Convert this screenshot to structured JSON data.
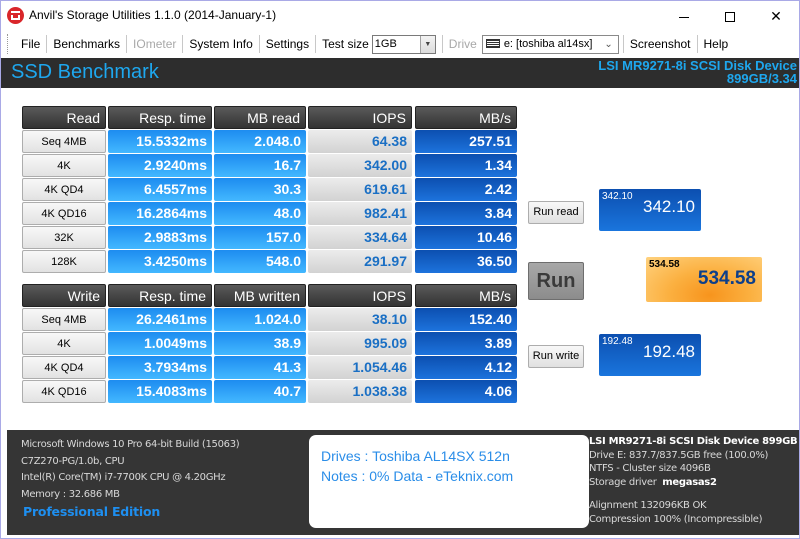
{
  "window": {
    "title": "Anvil's Storage Utilities 1.1.0 (2014-January-1)",
    "controls": {
      "minimize": "minimize",
      "maximize": "maximize",
      "close": "✕"
    }
  },
  "menu": {
    "items": [
      "File",
      "Benchmarks",
      "IOmeter",
      "System Info",
      "Settings"
    ],
    "test_size_label": "Test size",
    "test_size_value": "1GB",
    "drive_label": "Drive",
    "drive_value": "e: [toshiba al14sx]",
    "screenshot": "Screenshot",
    "help": "Help"
  },
  "header": {
    "title": "SSD Benchmark",
    "device_line1": "LSI MR9271-8i SCSI Disk Device",
    "device_line2": "899GB/3.34"
  },
  "read_table": {
    "headers": [
      "Read",
      "Resp. time",
      "MB read",
      "IOPS",
      "MB/s"
    ],
    "rows": [
      {
        "label": "Seq 4MB",
        "resp": "15.5332ms",
        "mb": "2.048.0",
        "iops": "64.38",
        "mbs": "257.51"
      },
      {
        "label": "4K",
        "resp": "2.9240ms",
        "mb": "16.7",
        "iops": "342.00",
        "mbs": "1.34"
      },
      {
        "label": "4K QD4",
        "resp": "6.4557ms",
        "mb": "30.3",
        "iops": "619.61",
        "mbs": "2.42"
      },
      {
        "label": "4K QD16",
        "resp": "16.2864ms",
        "mb": "48.0",
        "iops": "982.41",
        "mbs": "3.84"
      },
      {
        "label": "32K",
        "resp": "2.9883ms",
        "mb": "157.0",
        "iops": "334.64",
        "mbs": "10.46"
      },
      {
        "label": "128K",
        "resp": "3.4250ms",
        "mb": "548.0",
        "iops": "291.97",
        "mbs": "36.50"
      }
    ]
  },
  "write_table": {
    "headers": [
      "Write",
      "Resp. time",
      "MB written",
      "IOPS",
      "MB/s"
    ],
    "rows": [
      {
        "label": "Seq 4MB",
        "resp": "26.2461ms",
        "mb": "1.024.0",
        "iops": "38.10",
        "mbs": "152.40"
      },
      {
        "label": "4K",
        "resp": "1.0049ms",
        "mb": "38.9",
        "iops": "995.09",
        "mbs": "3.89"
      },
      {
        "label": "4K QD4",
        "resp": "3.7934ms",
        "mb": "41.3",
        "iops": "1.054.46",
        "mbs": "4.12"
      },
      {
        "label": "4K QD16",
        "resp": "15.4083ms",
        "mb": "40.7",
        "iops": "1.038.38",
        "mbs": "4.06"
      }
    ]
  },
  "actions": {
    "run_read": "Run read",
    "run": "Run",
    "run_write": "Run write"
  },
  "scores": {
    "read": {
      "small": "342.10",
      "big": "342.10"
    },
    "total": {
      "small": "534.58",
      "big": "534.58"
    },
    "write": {
      "small": "192.48",
      "big": "192.48"
    }
  },
  "system_info": {
    "os": "Microsoft Windows 10 Pro 64-bit Build (15063)",
    "board": "C7Z270-PG/1.0b, CPU",
    "cpu": "Intel(R) Core(TM) i7-7700K CPU @ 4.20GHz",
    "memory": "Memory : 32.686 MB",
    "edition": "Professional Edition"
  },
  "notes": {
    "drives": "Drives : Toshiba AL14SX 512n",
    "notes": "Notes : 0% Data - eTeknix.com"
  },
  "drive_info": {
    "device": "LSI MR9271-8i SCSI Disk Device 899GB",
    "free": "Drive E: 837.7/837.5GB free (100.0%)",
    "fs": "NTFS - Cluster size 4096B",
    "driver_label": "Storage driver",
    "driver_value": "megasas2",
    "alignment": "Alignment 132096KB OK",
    "compression": "Compression 100% (Incompressible)"
  },
  "colors": {
    "accent": "#1ea7ee",
    "header_bg": "#2d2d2d",
    "resp_cell": "#2b9ff5",
    "mbs_cell": "#1160c8",
    "iops_text": "#1a6fc4",
    "total_score": "#f7941d"
  }
}
